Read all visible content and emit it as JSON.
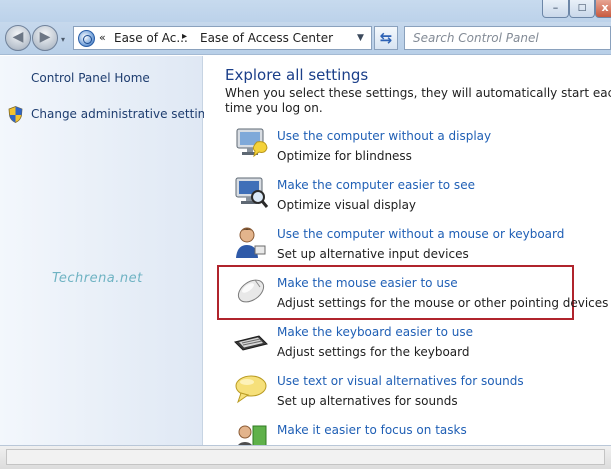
{
  "window": {
    "minimize_glyph": "–",
    "maximize_glyph": "□",
    "close_glyph": "x"
  },
  "navbar": {
    "back_glyph": "◀",
    "forward_glyph": "▶",
    "dropdown_glyph": "▾",
    "breadcrumb": {
      "chevron": "«",
      "items": [
        "Ease of Ac...",
        "Ease of Access Center"
      ],
      "separator": "▸"
    },
    "address_dropdown_glyph": "▼",
    "refresh_glyph": "⇆",
    "search_placeholder": "Search Control Panel"
  },
  "sidebar": {
    "home_label": "Control Panel Home",
    "admin_label": "Change administrative settings",
    "watermark": "Techrena.net"
  },
  "main": {
    "title": "Explore all settings",
    "intro": "When you select these settings, they will automatically start each time you log on.",
    "items": [
      {
        "icon": "monitor-speech-icon",
        "link": "Use the computer without a display",
        "desc": "Optimize for blindness"
      },
      {
        "icon": "monitor-magnifier-icon",
        "link": "Make the computer easier to see",
        "desc": "Optimize visual display"
      },
      {
        "icon": "person-speaking-icon",
        "link": "Use the computer without a mouse or keyboard",
        "desc": "Set up alternative input devices"
      },
      {
        "icon": "mouse-icon",
        "link": "Make the mouse easier to use",
        "desc": "Adjust settings for the mouse or other pointing devices"
      },
      {
        "icon": "keyboard-icon",
        "link": "Make the keyboard easier to use",
        "desc": "Adjust settings for the keyboard"
      },
      {
        "icon": "speech-bubble-icon",
        "link": "Use text or visual alternatives for sounds",
        "desc": "Set up alternatives for sounds"
      },
      {
        "icon": "focus-tasks-icon",
        "link": "Make it easier to focus on tasks",
        "desc": ""
      }
    ],
    "highlighted_item_index": 3,
    "highlight_color": "#b0242c"
  },
  "colors": {
    "link": "#1f5fb5",
    "title": "#1b3f89",
    "sidebar_link": "#1e3d6f"
  }
}
